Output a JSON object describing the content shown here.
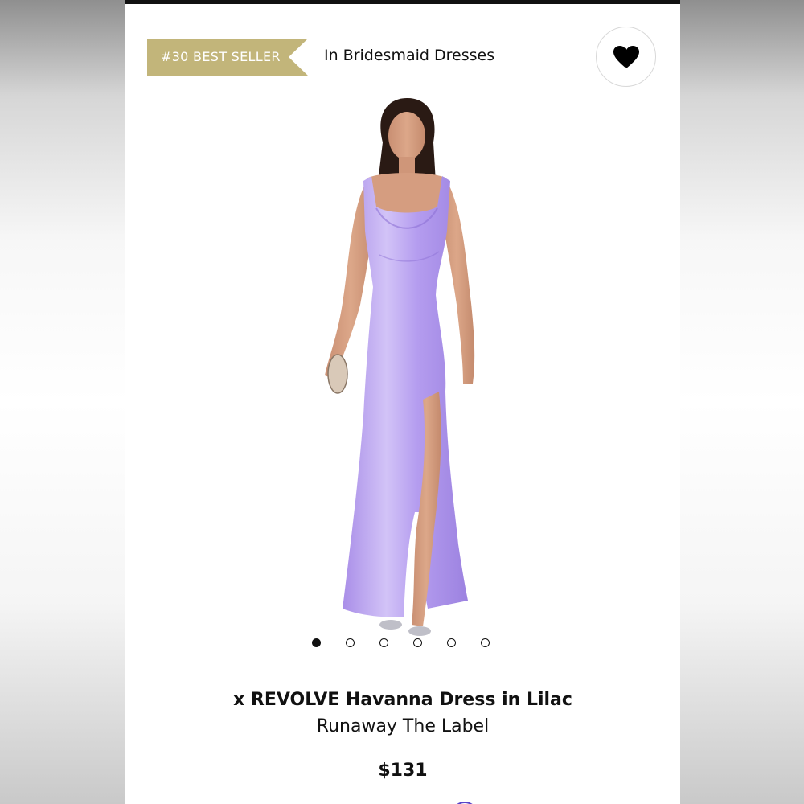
{
  "badge": {
    "label": "#30 BEST SELLER"
  },
  "category": {
    "label": "In Bridesmaid Dresses"
  },
  "favorite": {
    "icon": "heart-icon"
  },
  "product": {
    "image": "model-in-lilac-satin-gown",
    "title": "x REVOLVE Havanna Dress in Lilac",
    "brand": "Runaway The Label",
    "price": "$131"
  },
  "carousel": {
    "total": 6,
    "active": 1
  },
  "colors": {
    "badge_gold": "#c2b57a",
    "dress_lilac": "#b9a3ee",
    "text": "#111111"
  }
}
